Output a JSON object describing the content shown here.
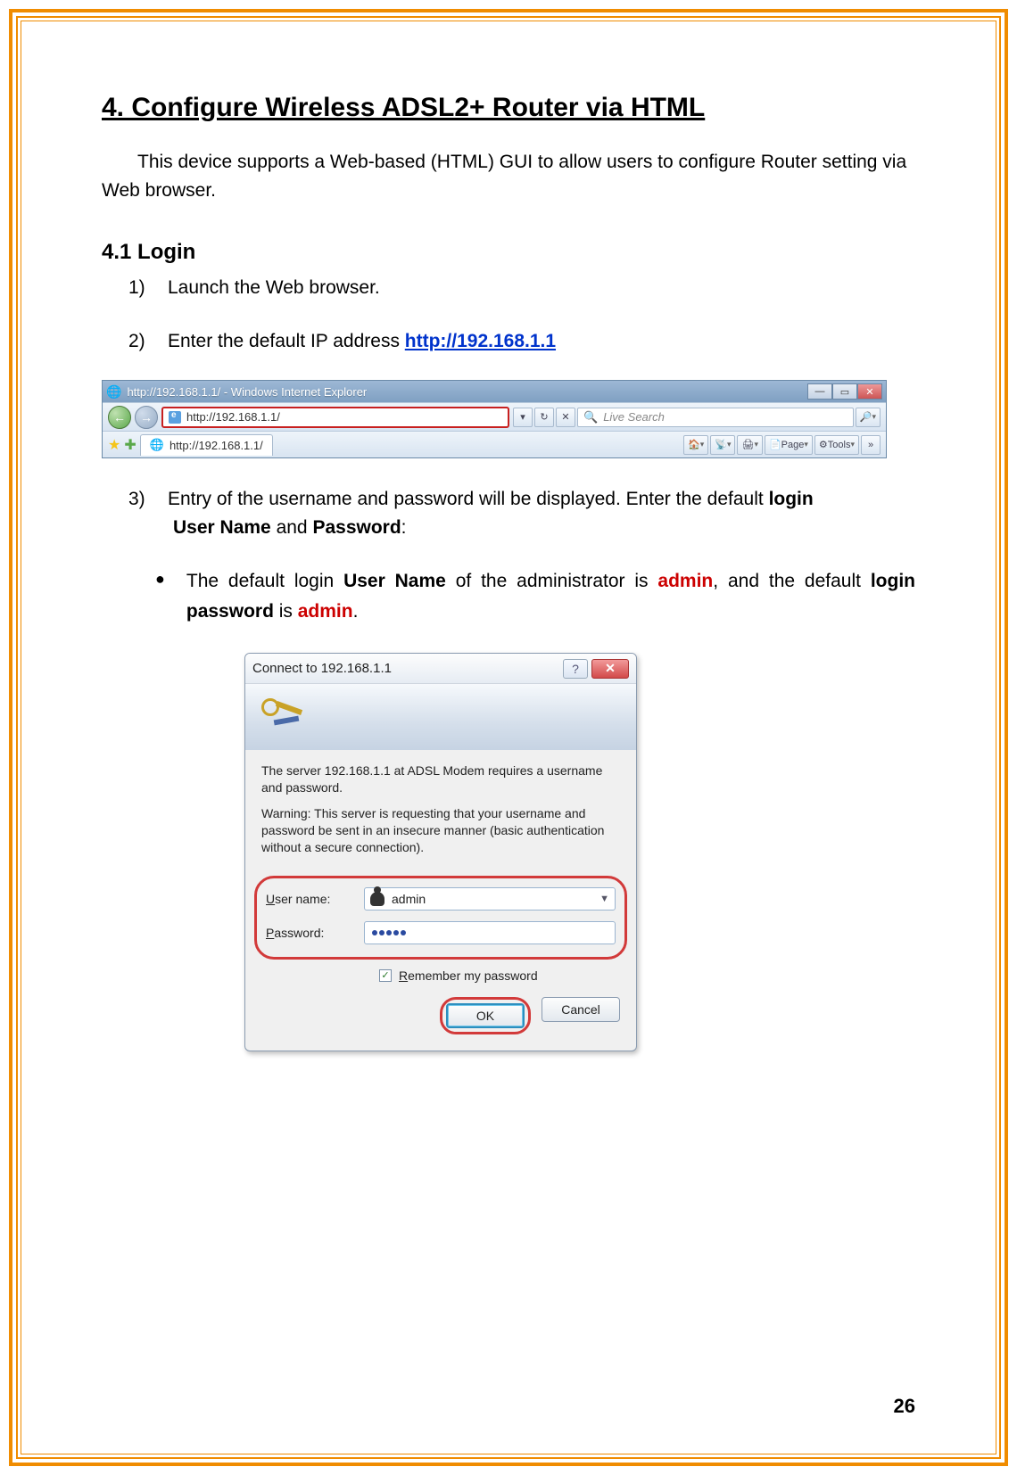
{
  "heading": "4. Configure Wireless ADSL2+ Router via HTML",
  "intro": "This device supports a Web-based (HTML) GUI to allow users to configure Router setting via Web browser.",
  "subheading": "4.1 Login",
  "steps": {
    "s1_num": "1)",
    "s1_text": "Launch the Web browser.",
    "s2_num": "2)",
    "s2_prefix": "Enter the default IP address ",
    "s2_link": "http://192.168.1.1",
    "s3_num": "3)",
    "s3_a": "Entry of the username and password will be displayed. Enter the default ",
    "s3_login": "login",
    "s3_b": "User Name",
    "s3_and": " and ",
    "s3_c": "Password",
    "s3_colon": ":"
  },
  "bullet": {
    "pre": "The default login ",
    "un": "User Name",
    "mid1": " of the administrator is ",
    "adm1": "admin",
    "mid2": ", and the default ",
    "lp": "login password",
    "mid3": " is ",
    "adm2": "admin",
    "dot": "."
  },
  "ie": {
    "title": "http://192.168.1.1/ - Windows Internet Explorer",
    "address": "http://192.168.1.1/",
    "search_placeholder": "Live Search",
    "tab_label": "http://192.168.1.1/",
    "tool_page": "Page",
    "tool_tools": "Tools"
  },
  "auth": {
    "title": "Connect to 192.168.1.1",
    "msg1": "The server 192.168.1.1 at ADSL Modem requires a username and password.",
    "msg2": "Warning: This server is requesting that your username and password be sent in an insecure manner (basic authentication without a secure connection).",
    "label_user_pre": "U",
    "label_user_rest": "ser name:",
    "label_pw_pre": "P",
    "label_pw_rest": "assword:",
    "user_value": "admin",
    "remember_pre": "R",
    "remember_rest": "emember my password",
    "ok": "OK",
    "cancel": "Cancel"
  },
  "page_number": "26"
}
